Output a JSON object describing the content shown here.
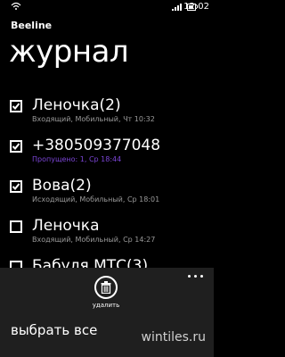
{
  "status_bar": {
    "time": "12:02"
  },
  "header": {
    "app_name": "Beeline",
    "page_title": "журнал"
  },
  "call_log": [
    {
      "name": "Леночка",
      "count": "(2)",
      "detail": "Входящий, Мобильный, Чт 10:32",
      "checked": true,
      "missed": false
    },
    {
      "name": "+380509377048",
      "count": "",
      "detail": "Пропущено: 1, Ср 18:44",
      "checked": true,
      "missed": true
    },
    {
      "name": "Вова",
      "count": "(2)",
      "detail": "Исходящий, Мобильный, Ср 18:01",
      "checked": true,
      "missed": false
    },
    {
      "name": "Леночка",
      "count": "",
      "detail": "Входящий, Мобильный, Ср 14:27",
      "checked": false,
      "missed": false
    },
    {
      "name": "Бабуля МТС",
      "count": "(3)",
      "detail": "",
      "checked": false,
      "missed": false
    }
  ],
  "app_bar": {
    "delete_label": "удалить",
    "select_all_label": "выбрать все"
  },
  "watermark": "wintiles.ru",
  "colors": {
    "background": "#000000",
    "missed_call": "#7b45d6",
    "app_bar": "#1f1f1f"
  }
}
